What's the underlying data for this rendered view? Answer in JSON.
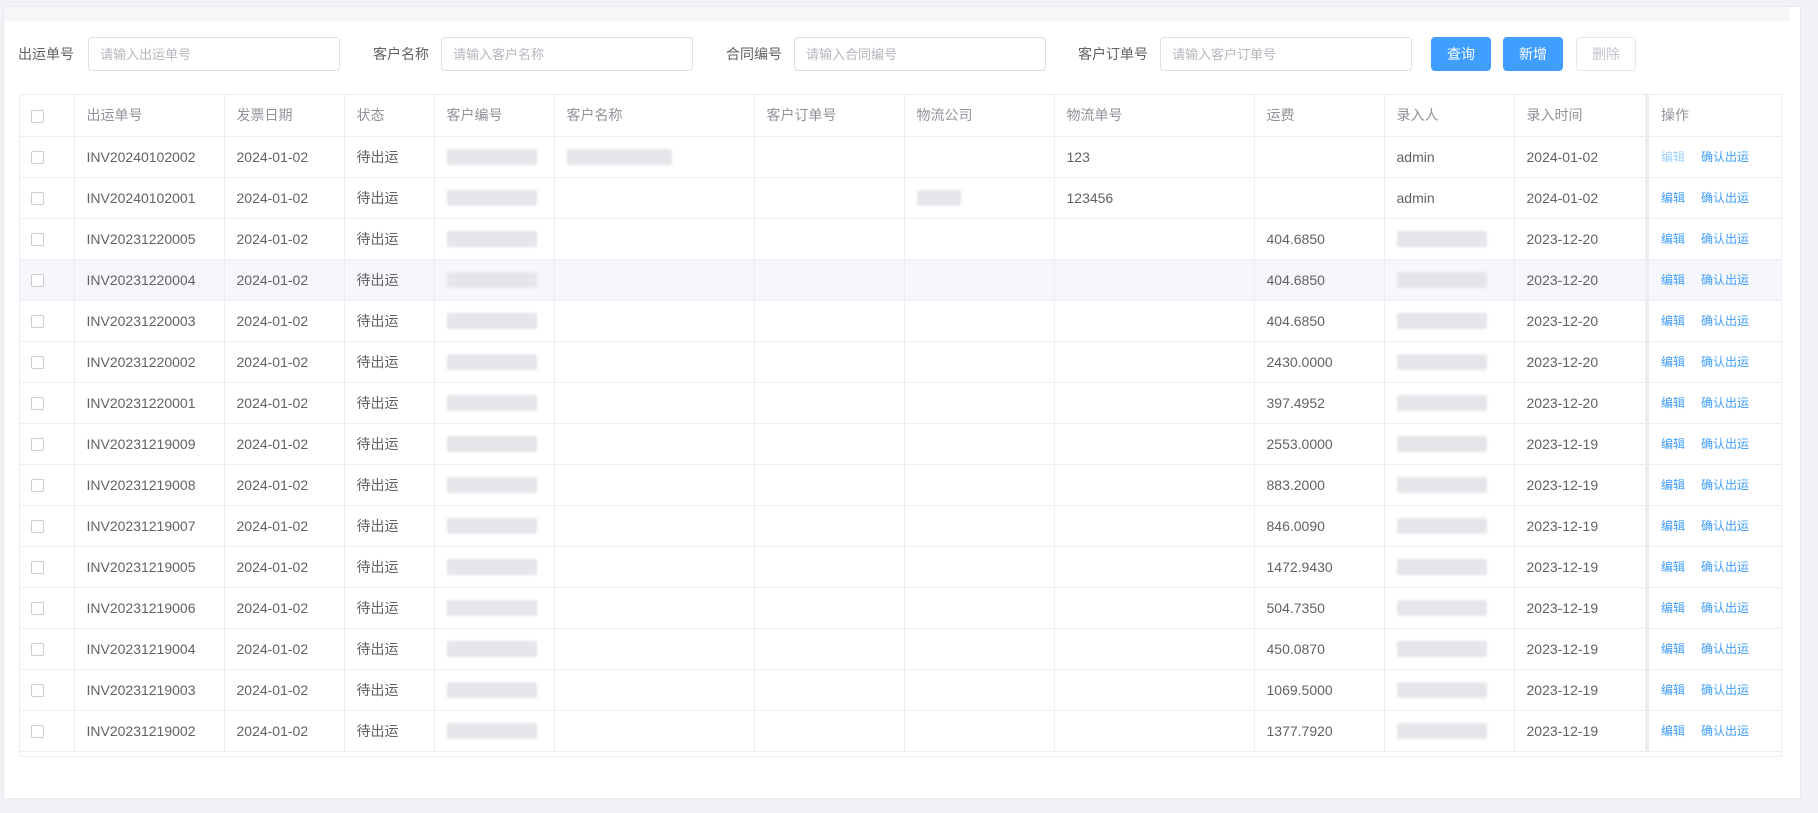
{
  "filters": [
    {
      "label": "出运单号",
      "placeholder": "请输入出运单号"
    },
    {
      "label": "客户名称",
      "placeholder": "请输入客户名称"
    },
    {
      "label": "合同编号",
      "placeholder": "请输入合同编号"
    },
    {
      "label": "客户订单号",
      "placeholder": "请输入客户订单号"
    }
  ],
  "buttons": {
    "query": "查询",
    "add": "新增",
    "delete": "删除"
  },
  "columns": [
    "出运单号",
    "发票日期",
    "状态",
    "客户编号",
    "客户名称",
    "客户订单号",
    "物流公司",
    "物流单号",
    "运费",
    "录入人",
    "录入时间",
    "操作"
  ],
  "actions": {
    "edit": "编辑",
    "confirm": "确认出运"
  },
  "rows": [
    {
      "no": "INV20240102002",
      "date": "2024-01-02",
      "status": "待出运",
      "logistics_no": "123",
      "freight": "",
      "creator": "admin",
      "created": "2024-01-02"
    },
    {
      "no": "INV20240102001",
      "date": "2024-01-02",
      "status": "待出运",
      "logistics_no": "123456",
      "freight": "",
      "creator": "admin",
      "created": "2024-01-02"
    },
    {
      "no": "INV20231220005",
      "date": "2024-01-02",
      "status": "待出运",
      "logistics_no": "",
      "freight": "404.6850",
      "creator": "",
      "created": "2023-12-20"
    },
    {
      "no": "INV20231220004",
      "date": "2024-01-02",
      "status": "待出运",
      "logistics_no": "",
      "freight": "404.6850",
      "creator": "",
      "created": "2023-12-20"
    },
    {
      "no": "INV20231220003",
      "date": "2024-01-02",
      "status": "待出运",
      "logistics_no": "",
      "freight": "404.6850",
      "creator": "",
      "created": "2023-12-20"
    },
    {
      "no": "INV20231220002",
      "date": "2024-01-02",
      "status": "待出运",
      "logistics_no": "",
      "freight": "2430.0000",
      "creator": "",
      "created": "2023-12-20"
    },
    {
      "no": "INV20231220001",
      "date": "2024-01-02",
      "status": "待出运",
      "logistics_no": "",
      "freight": "397.4952",
      "creator": "",
      "created": "2023-12-20"
    },
    {
      "no": "INV20231219009",
      "date": "2024-01-02",
      "status": "待出运",
      "logistics_no": "",
      "freight": "2553.0000",
      "creator": "",
      "created": "2023-12-19"
    },
    {
      "no": "INV20231219008",
      "date": "2024-01-02",
      "status": "待出运",
      "logistics_no": "",
      "freight": "883.2000",
      "creator": "",
      "created": "2023-12-19"
    },
    {
      "no": "INV20231219007",
      "date": "2024-01-02",
      "status": "待出运",
      "logistics_no": "",
      "freight": "846.0090",
      "creator": "",
      "created": "2023-12-19"
    },
    {
      "no": "INV20231219005",
      "date": "2024-01-02",
      "status": "待出运",
      "logistics_no": "",
      "freight": "1472.9430",
      "creator": "",
      "created": "2023-12-19"
    },
    {
      "no": "INV20231219006",
      "date": "2024-01-02",
      "status": "待出运",
      "logistics_no": "",
      "freight": "504.7350",
      "creator": "",
      "created": "2023-12-19"
    },
    {
      "no": "INV20231219004",
      "date": "2024-01-02",
      "status": "待出运",
      "logistics_no": "",
      "freight": "450.0870",
      "creator": "",
      "created": "2023-12-19"
    },
    {
      "no": "INV20231219003",
      "date": "2024-01-02",
      "status": "待出运",
      "logistics_no": "",
      "freight": "1069.5000",
      "creator": "",
      "created": "2023-12-19"
    },
    {
      "no": "INV20231219002",
      "date": "2024-01-02",
      "status": "待出运",
      "logistics_no": "",
      "freight": "1377.7920",
      "creator": "",
      "created": "2023-12-19"
    }
  ]
}
